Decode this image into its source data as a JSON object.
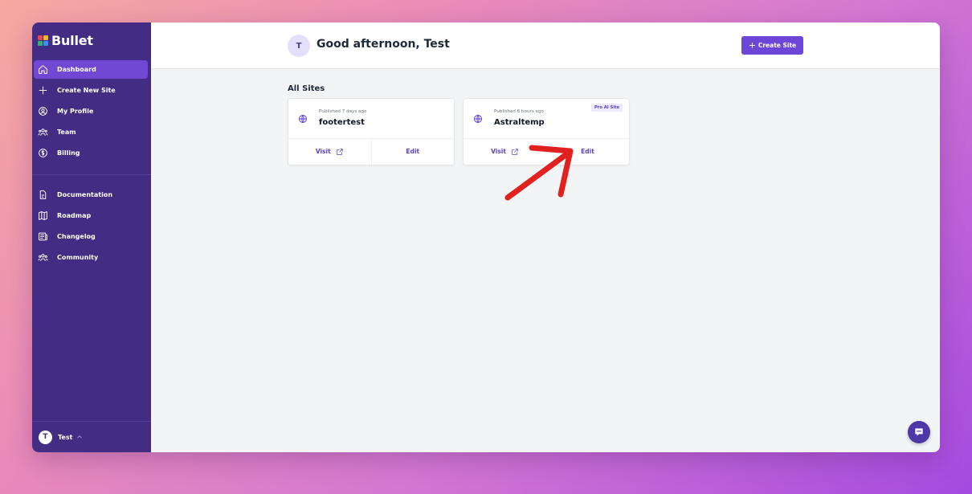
{
  "brand": {
    "name": "Bullet",
    "colors": [
      "#e9484a",
      "#f6b52e",
      "#34b36a",
      "#3e8ef0"
    ]
  },
  "sidebar": {
    "items": [
      {
        "label": "Dashboard",
        "icon": "home-icon",
        "active": true
      },
      {
        "label": "Create New Site",
        "icon": "plus-icon"
      },
      {
        "label": "My Profile",
        "icon": "user-circle-icon"
      },
      {
        "label": "Team",
        "icon": "team-icon"
      },
      {
        "label": "Billing",
        "icon": "dollar-icon"
      }
    ],
    "resources": [
      {
        "label": "Documentation",
        "icon": "document-icon"
      },
      {
        "label": "Roadmap",
        "icon": "map-icon"
      },
      {
        "label": "Changelog",
        "icon": "newspaper-icon"
      },
      {
        "label": "Community",
        "icon": "community-icon"
      }
    ],
    "user": {
      "initial": "T",
      "name": "Test"
    }
  },
  "header": {
    "avatar_initial": "T",
    "greeting": "Good afternoon, Test",
    "create_button": "Create Site"
  },
  "main": {
    "section_title": "All Sites",
    "sites": [
      {
        "published": "Published 7 days ago",
        "name": "footertest",
        "badge": "",
        "visit": "Visit",
        "edit": "Edit"
      },
      {
        "published": "Published 6 hours ago",
        "name": "Astraltemp",
        "badge": "Pro AI Site",
        "visit": "Visit",
        "edit": "Edit"
      }
    ]
  },
  "colors": {
    "sidebar_bg": "#422c84",
    "active_item": "#7048d4",
    "accent": "#6c46d6",
    "annotation_arrow": "#e0211f"
  }
}
